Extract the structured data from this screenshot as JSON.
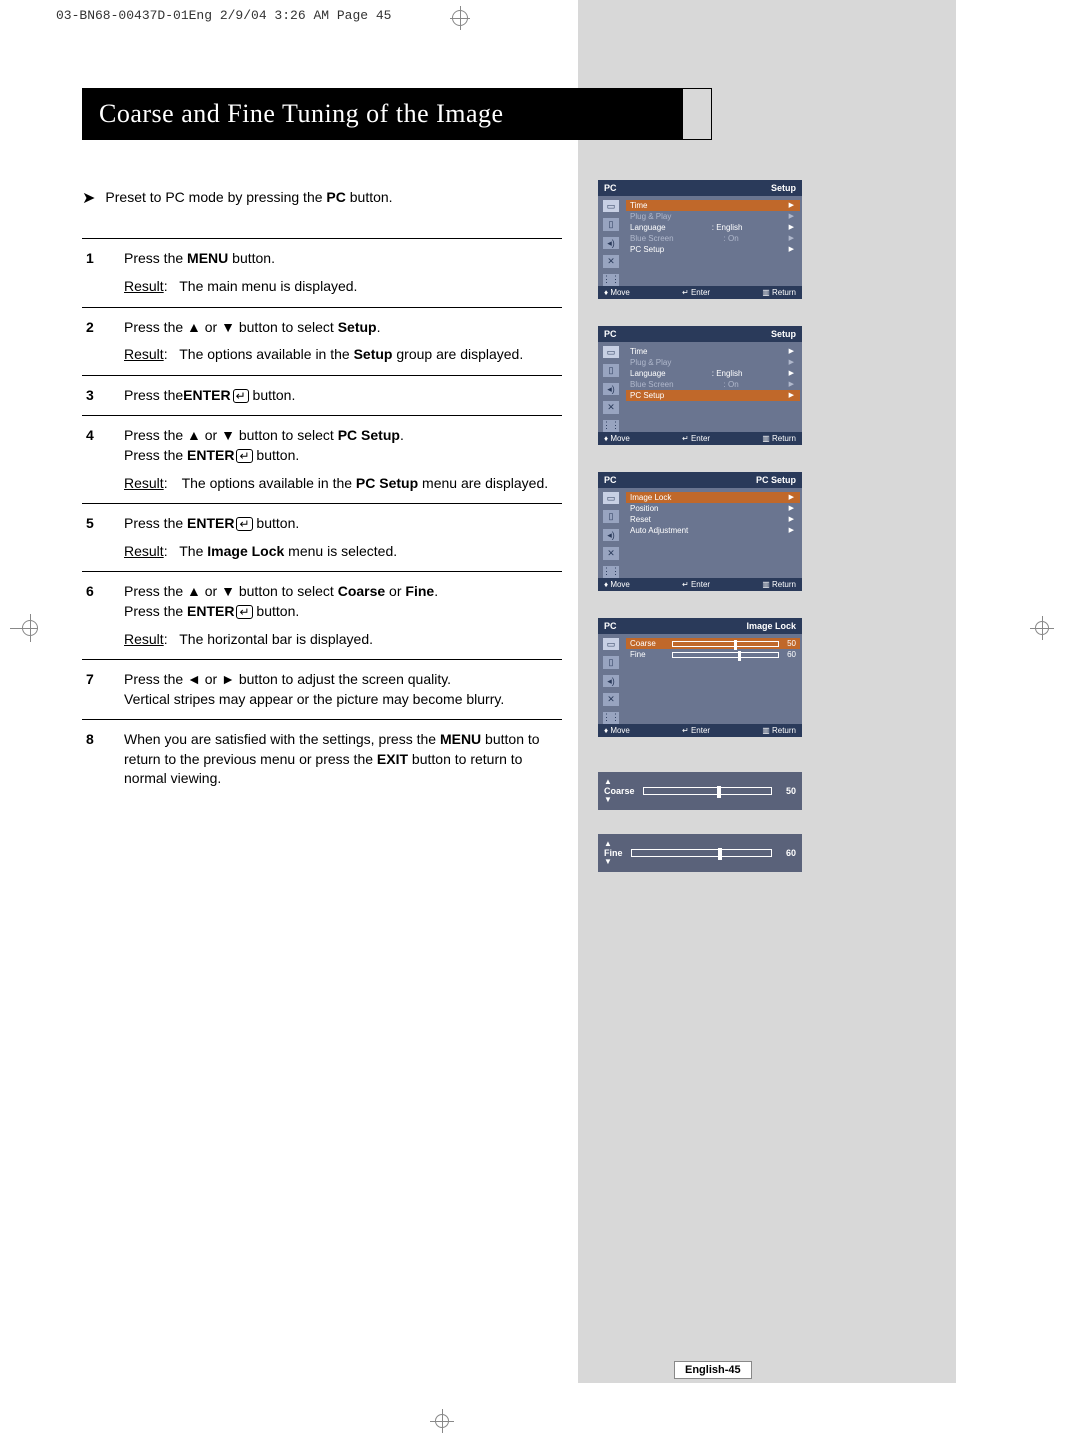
{
  "header_stamp": "03-BN68-00437D-01Eng  2/9/04 3:26 AM  Page 45",
  "title": "Coarse and Fine Tuning of the Image",
  "note": {
    "prefix_text": "Preset to PC mode by pressing the ",
    "bold": "PC",
    "suffix": " button."
  },
  "steps": {
    "s1": {
      "num": "1",
      "l1a": "Press the ",
      "l1b": "MENU",
      "l1c": " button.",
      "rlabel": "Result",
      "rtext": "The main menu is displayed."
    },
    "s2": {
      "num": "2",
      "l1a": "Press the ▲ or ▼ button to select ",
      "l1b": "Setup",
      "l1c": ".",
      "rlabel": "Result",
      "rtext_a": "The options available in the ",
      "rtext_b": "Setup",
      "rtext_c": " group are displayed."
    },
    "s3": {
      "num": "3",
      "l1a": "Press the",
      "l1b": "ENTER",
      "l1c": " button."
    },
    "s4": {
      "num": "4",
      "l1a": "Press the ▲ or ▼ button to select ",
      "l1b": "PC Setup",
      "l1c": ".",
      "l2a": "Press the ",
      "l2b": "ENTER",
      "l2c": "  button.",
      "rlabel": "Result",
      "rtext_a": "The options available in the ",
      "rtext_b": "PC Setup",
      "rtext_c": " menu are displayed."
    },
    "s5": {
      "num": "5",
      "l1a": "Press the ",
      "l1b": "ENTER",
      "l1c": "  button.",
      "rlabel": "Result",
      "rtext_a": "The ",
      "rtext_b": "Image Lock",
      "rtext_c": " menu is selected."
    },
    "s6": {
      "num": "6",
      "l1a": "Press the ▲ or ▼ button to select ",
      "l1b": "Coarse",
      "l1mid": " or ",
      "l1d": "Fine",
      "l1c": ".",
      "l2a": "Press the ",
      "l2b": "ENTER",
      "l2c": "  button.",
      "rlabel": "Result",
      "rtext": "The horizontal bar is displayed."
    },
    "s7": {
      "num": "7",
      "l1": "Press the ◄ or ► button to adjust the screen quality.",
      "l2": "Vertical stripes may appear or the picture may become blurry."
    },
    "s8": {
      "num": "8",
      "l1a": "When you are satisfied with the settings, press the ",
      "l1b": "MENU",
      "l1c": " button to return to the previous menu or press the ",
      "l1d": "EXIT",
      "l1e": " button to return to normal viewing."
    }
  },
  "osd_common": {
    "pc": "PC",
    "move": "Move",
    "enter": "Enter",
    "ret": "Return"
  },
  "osd1": {
    "title": "Setup",
    "rows": {
      "time": "Time",
      "pnp": "Plug & Play",
      "lang": "Language",
      "lang_val": ":   English",
      "blue": "Blue Screen",
      "blue_val": ":   On",
      "pcsetup": "PC Setup"
    }
  },
  "osd2": {
    "title": "Setup"
  },
  "osd3": {
    "title": "PC Setup",
    "rows": {
      "il": "Image Lock",
      "pos": "Position",
      "reset": "Reset",
      "auto": "Auto Adjustment"
    }
  },
  "osd4": {
    "title": "Image Lock",
    "coarse": "Coarse",
    "coarse_val": "50",
    "fine": "Fine",
    "fine_val": "60"
  },
  "slider_coarse": {
    "label": "Coarse",
    "val": "50"
  },
  "slider_fine": {
    "label": "Fine",
    "val": "60"
  },
  "page_label": "English-45"
}
